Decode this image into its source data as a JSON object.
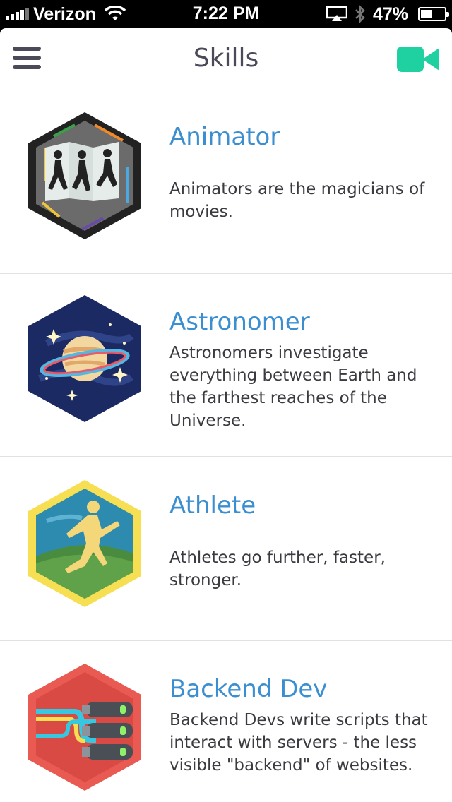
{
  "status_bar": {
    "carrier": "Verizon",
    "time": "7:22 PM",
    "battery_percent": "47%",
    "battery_level": 0.47
  },
  "header": {
    "title": "Skills",
    "menu_icon": "hamburger-menu-icon",
    "video_icon": "video-camera-icon",
    "accent_color": "#1fd1a0"
  },
  "skills": [
    {
      "name": "Animator",
      "description": "Animators are the magicians of movies.",
      "icon": "animator-badge-icon"
    },
    {
      "name": "Astronomer",
      "description": "Astronomers investigate everything between Earth and the farthest reaches of the Universe.",
      "icon": "astronomer-badge-icon"
    },
    {
      "name": "Athlete",
      "description": "Athletes go further, faster, stronger.",
      "icon": "athlete-badge-icon"
    },
    {
      "name": "Backend Dev",
      "description": "Backend Devs write scripts that interact with servers - the less visible \"backend\" of websites.",
      "icon": "backend-dev-badge-icon"
    }
  ],
  "colors": {
    "skill_title": "#3b8fd0",
    "text": "#3a3a40",
    "divider": "#e1e1e4"
  }
}
